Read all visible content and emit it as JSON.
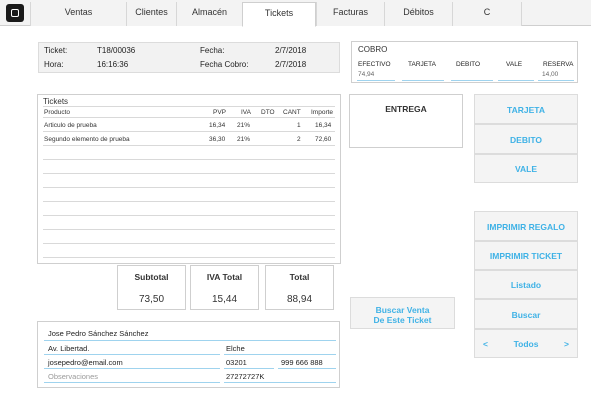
{
  "tabs": [
    "Ventas",
    "Clientes",
    "Almacén",
    "Tickets",
    "Facturas",
    "Débitos",
    "C"
  ],
  "ticket_info": {
    "ticket_label": "Ticket:",
    "ticket_value": "T18/00036",
    "hora_label": "Hora:",
    "hora_value": "16:16:36",
    "fecha_label": "Fecha:",
    "fecha_value": "2/7/2018",
    "fecha_cobro_label": "Fecha Cobro:",
    "fecha_cobro_value": "2/7/2018"
  },
  "cobro": {
    "title": "COBRO",
    "headers": [
      "EFECTIVO",
      "TARJETA",
      "DEBITO",
      "VALE",
      "RESERVA"
    ],
    "values": [
      "74,94",
      "",
      "",
      "",
      "14,00"
    ]
  },
  "tickets": {
    "title": "Tickets",
    "columns": [
      "Producto",
      "PVP",
      "IVA",
      "DTO",
      "CANT",
      "Importe"
    ],
    "rows": [
      [
        "Articulo de prueba",
        "16,34",
        "21%",
        "",
        "1",
        "16,34"
      ],
      [
        "Segundo elemento de prueba",
        "36,30",
        "21%",
        "",
        "2",
        "72,60"
      ]
    ]
  },
  "totals": {
    "subtotal_label": "Subtotal",
    "subtotal_value": "73,50",
    "iva_label": "IVA Total",
    "iva_value": "15,44",
    "total_label": "Total",
    "total_value": "88,94"
  },
  "entrega_label": "ENTREGA",
  "buttons": {
    "tarjeta": "TARJETA",
    "debito": "DEBITO",
    "vale": "VALE",
    "buscar_venta_1": "Buscar Venta",
    "buscar_venta_2": "De Este Ticket",
    "imprimir_regalo": "IMPRIMIR REGALO",
    "imprimir_ticket": "IMPRIMIR TICKET",
    "listado": "Listado",
    "buscar": "Buscar",
    "prev": "<",
    "todos": "Todos",
    "next": ">"
  },
  "customer": {
    "name": "Jose Pedro Sánchez Sánchez",
    "address": "Av. Libertad.",
    "city": "Elche",
    "email": "josepedro@email.com",
    "postal": "03201",
    "phone": "999 666 888",
    "observaciones_placeholder": "Observaciones",
    "nif": "27272727K"
  },
  "colors": {
    "accent": "#3fb2e6",
    "panel_bg": "#f2f2f2",
    "border": "#cfcfcf"
  }
}
